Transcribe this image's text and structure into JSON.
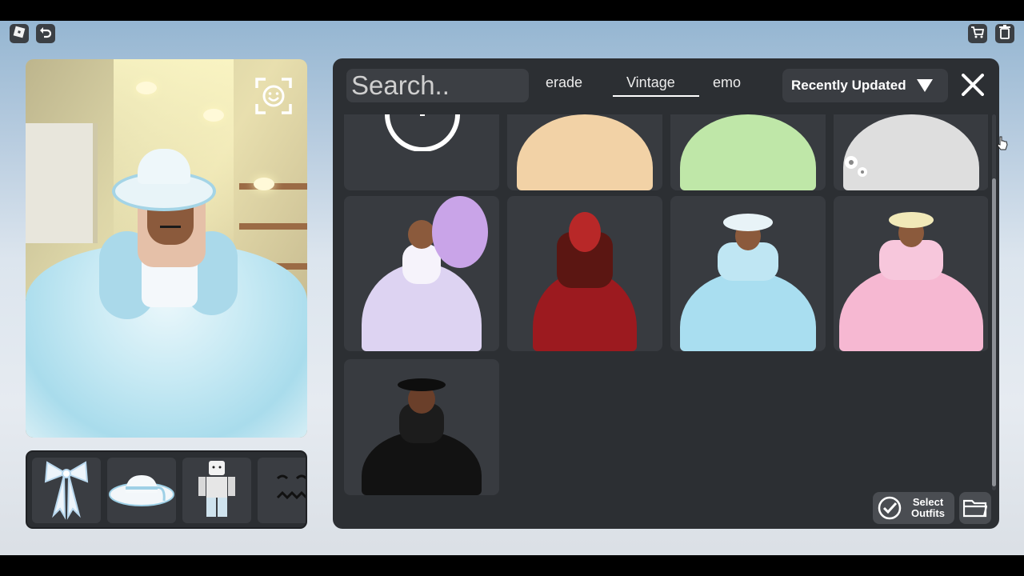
{
  "topbar": {
    "roblox_icon": "roblox-logo-icon",
    "back_icon": "undo-icon",
    "cart_icon": "cart-icon",
    "trash_icon": "trash-icon"
  },
  "preview": {
    "face_button_icon": "face-camera-icon"
  },
  "accessories": [
    {
      "name": "bow",
      "icon": "bow-icon"
    },
    {
      "name": "hat",
      "icon": "hat-icon"
    },
    {
      "name": "body",
      "icon": "avatar-body-icon"
    },
    {
      "name": "face",
      "icon": "face-icon"
    }
  ],
  "outfits_panel": {
    "search_placeholder": "Search..",
    "tabs": [
      {
        "label": "erade",
        "selected": false
      },
      {
        "label": "Vintage",
        "selected": true
      },
      {
        "label": "emo",
        "selected": false
      }
    ],
    "sort": {
      "label": "Recently Updated"
    },
    "select_button": {
      "label": "Select Outfits"
    },
    "folder_icon": "folder-icon",
    "close_icon": "close-icon"
  },
  "outfit_cards": [
    {
      "kind": "create",
      "icon": "plus-icon"
    },
    {
      "kind": "outfit",
      "dress_color": "#f2d2a6"
    },
    {
      "kind": "outfit",
      "dress_color": "#bfe7a8"
    },
    {
      "kind": "outfit",
      "dress_color": "#dedede",
      "has_settings": true
    },
    {
      "kind": "outfit",
      "dress_color": "#ddd3f2"
    },
    {
      "kind": "outfit",
      "dress_color": "#9c1a1f"
    },
    {
      "kind": "outfit",
      "dress_color": "#a9def0"
    },
    {
      "kind": "outfit",
      "dress_color": "#f6b8d2"
    },
    {
      "kind": "outfit",
      "dress_color": "#121212"
    }
  ],
  "colors": {
    "panel_bg": "#2c2f33",
    "card_bg": "#383b40",
    "accent": "#ffffff"
  }
}
